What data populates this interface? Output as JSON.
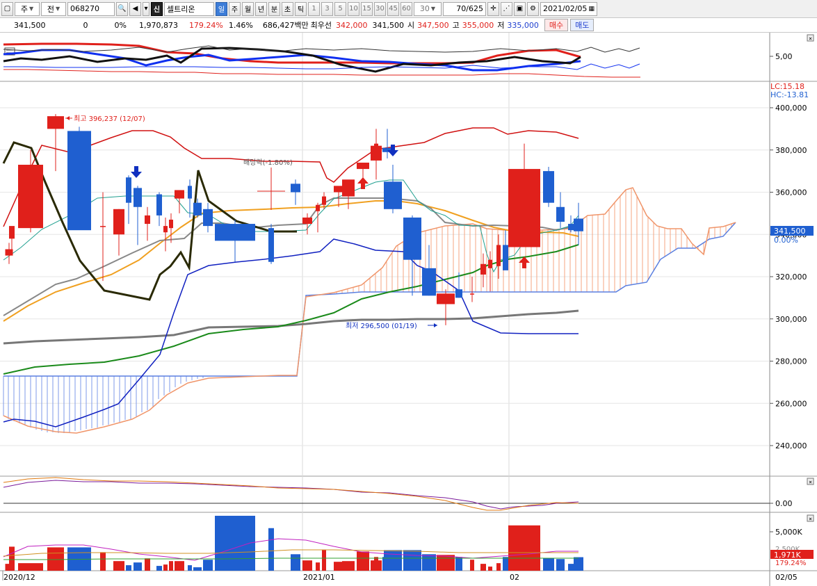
{
  "toolbar": {
    "period_label": "주",
    "prev_label": "전",
    "code": "068270",
    "stock_badge": "신",
    "stock_name": "셀트리온",
    "timeframes": [
      "일",
      "주",
      "월",
      "년",
      "분",
      "초",
      "틱"
    ],
    "intervals": [
      "1",
      "3",
      "5",
      "10",
      "15",
      "30",
      "45",
      "60"
    ],
    "count_value": "30",
    "range_value": "70/625",
    "date_value": "2021/02/05",
    "icons": [
      "window-icon",
      "search-icon",
      "speaker-icon",
      "crosshair-icon",
      "dotted-chart-icon",
      "save-icon",
      "gear-icon",
      "calendar-icon"
    ]
  },
  "quote": {
    "price": "341,500",
    "change": "0",
    "change_pct": "0%",
    "volume": "1,970,873",
    "volume_ratio": "179.24%",
    "turnover": "1.46%",
    "amount": "686,427백만",
    "best_label": "최우선",
    "best_ask": "342,000",
    "best_bid": "341,500",
    "open_label": "시",
    "open": "347,500",
    "high_label": "고",
    "high": "355,000",
    "low_label": "저",
    "low": "335,000",
    "buy_label": "매수",
    "sell_label": "매도"
  },
  "colors": {
    "up": "#e0201b",
    "down": "#1f5fd0",
    "bollinger": "#d01010",
    "price_label_bg": "#1f5fd0",
    "volume_label_bg": "#e0201b"
  },
  "indicator_pane": {
    "tick": "5,00"
  },
  "price_pane": {
    "lc": "LC:15.18",
    "hc": "HC:-13.81",
    "y_ticks": [
      "400,000",
      "380,000",
      "360,000",
      "340,000",
      "320,000",
      "300,000",
      "280,000",
      "260,000",
      "240,000"
    ],
    "current_price": "341,500",
    "current_pct": "0.00%",
    "high_annotation": "최고 396,237 (12/07)",
    "low_annotation": "최저 296,500 (01/19)",
    "dividend_annotation": "배당락(-1.80%)"
  },
  "oscillator_pane": {
    "tick": "0.00"
  },
  "volume_pane": {
    "y_tick": "5,000K",
    "mid_tick": "2,500K",
    "current_volume": "1,971K",
    "volume_pct": "179.24%"
  },
  "x_axis": {
    "labels": [
      "2020/12",
      "2021/01",
      "02"
    ],
    "right_label": "02/05"
  },
  "chart_data": {
    "type": "candlestick",
    "ylim": [
      230000,
      410000
    ],
    "candles": [
      {
        "o": 330000,
        "h": 336000,
        "l": 326000,
        "c": 333000
      },
      {
        "o": 338000,
        "h": 342000,
        "l": 333000,
        "c": 344000
      },
      {
        "o": 343000,
        "h": 380000,
        "l": 341000,
        "c": 373000
      },
      {
        "o": 390000,
        "h": 397000,
        "l": 370000,
        "c": 396000
      },
      {
        "o": 389000,
        "h": 391000,
        "l": 345000,
        "c": 342000
      },
      {
        "o": 344000,
        "h": 360000,
        "l": 318000,
        "c": 344000
      },
      {
        "o": 340000,
        "h": 352000,
        "l": 330000,
        "c": 352000
      },
      {
        "o": 367000,
        "h": 368000,
        "l": 345000,
        "c": 355000
      },
      {
        "o": 362000,
        "h": 363000,
        "l": 335000,
        "c": 353000
      },
      {
        "o": 345000,
        "h": 353000,
        "l": 337000,
        "c": 349000
      },
      {
        "o": 359000,
        "h": 360000,
        "l": 344000,
        "c": 349000
      },
      {
        "o": 341000,
        "h": 348000,
        "l": 332000,
        "c": 344000
      },
      {
        "o": 343000,
        "h": 350000,
        "l": 336000,
        "c": 347000
      },
      {
        "o": 357000,
        "h": 361000,
        "l": 350000,
        "c": 361000
      },
      {
        "o": 363000,
        "h": 366000,
        "l": 348000,
        "c": 357000
      },
      {
        "o": 355000,
        "h": 357000,
        "l": 348000,
        "c": 349000
      },
      {
        "o": 352000,
        "h": 355000,
        "l": 341000,
        "c": 344000
      },
      {
        "o": 345000,
        "h": 347000,
        "l": 327000,
        "c": 337000
      },
      {
        "o": 343000,
        "h": 345000,
        "l": 326000,
        "c": 327000
      },
      {
        "o": 364000,
        "h": 366000,
        "l": 354000,
        "c": 360000
      },
      {
        "o": 345000,
        "h": 350000,
        "l": 340000,
        "c": 348000
      },
      {
        "o": 351000,
        "h": 355000,
        "l": 341000,
        "c": 354000
      },
      {
        "o": 354000,
        "h": 360000,
        "l": 352000,
        "c": 358000
      },
      {
        "o": 360000,
        "h": 362000,
        "l": 353000,
        "c": 363000
      },
      {
        "o": 358000,
        "h": 365000,
        "l": 352000,
        "c": 366000
      },
      {
        "o": 371000,
        "h": 374000,
        "l": 362000,
        "c": 374000
      },
      {
        "o": 375000,
        "h": 381000,
        "l": 366000,
        "c": 382000
      },
      {
        "o": 379000,
        "h": 390000,
        "l": 374000,
        "c": 383000
      },
      {
        "o": 381000,
        "h": 390000,
        "l": 376000,
        "c": 379000
      },
      {
        "o": 365000,
        "h": 373000,
        "l": 350000,
        "c": 352000
      },
      {
        "o": 348000,
        "h": 349000,
        "l": 311000,
        "c": 328000
      },
      {
        "o": 324000,
        "h": 335000,
        "l": 311000,
        "c": 311000
      },
      {
        "o": 307000,
        "h": 314000,
        "l": 297000,
        "c": 312000
      },
      {
        "o": 314000,
        "h": 322000,
        "l": 310000,
        "c": 310000
      },
      {
        "o": 312000,
        "h": 320000,
        "l": 308000,
        "c": 312000
      },
      {
        "o": 321000,
        "h": 331000,
        "l": 315000,
        "c": 326000
      },
      {
        "o": 324000,
        "h": 332000,
        "l": 313000,
        "c": 328000
      },
      {
        "o": 325000,
        "h": 340000,
        "l": 319000,
        "c": 335000
      },
      {
        "o": 335000,
        "h": 342000,
        "l": 326000,
        "c": 323000
      },
      {
        "o": 334000,
        "h": 383000,
        "l": 334000,
        "c": 371000
      },
      {
        "o": 370000,
        "h": 372000,
        "l": 353000,
        "c": 355000
      },
      {
        "o": 353000,
        "h": 360000,
        "l": 343000,
        "c": 346000
      },
      {
        "o": 345000,
        "h": 349000,
        "l": 341000,
        "c": 342000
      },
      {
        "o": 347500,
        "h": 355000,
        "l": 335000,
        "c": 341500
      }
    ],
    "volumes_k": [
      1000,
      3500,
      1100,
      3400,
      3400,
      2700,
      1400,
      800,
      1200,
      1800,
      700,
      900,
      1400,
      1400,
      800,
      500,
      1600,
      8000,
      6200,
      2400,
      1500,
      1200,
      3000,
      1300,
      1400,
      2800,
      1500,
      2000,
      2000,
      3000,
      3000,
      2400,
      2300,
      2000,
      1600,
      1000,
      600,
      1100,
      2000,
      6600,
      1800,
      1700,
      1000,
      1971
    ]
  }
}
